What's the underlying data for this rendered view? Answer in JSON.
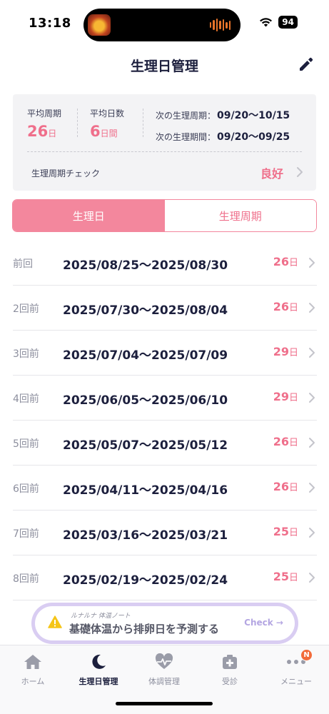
{
  "status_bar": {
    "time": "13:18",
    "battery": "94"
  },
  "header": {
    "title": "生理日管理"
  },
  "summary": {
    "avg_cycle": {
      "label": "平均周期",
      "value": "26",
      "unit": "日"
    },
    "avg_days": {
      "label": "平均日数",
      "value": "6",
      "unit": "日間"
    },
    "next_cycle": {
      "label": "次の生理周期：",
      "value": "09/20〜10/15"
    },
    "next_period": {
      "label": "次の生理期間：",
      "value": "09/20〜09/25"
    },
    "cycle_check": {
      "label": "生理周期チェック",
      "status": "良好"
    }
  },
  "tabs": {
    "period_days": "生理日",
    "cycle": "生理周期",
    "active": "生理日"
  },
  "history": [
    {
      "index": "前回",
      "range": "2025/08/25〜2025/08/30",
      "days": "26",
      "unit": "日"
    },
    {
      "index": "2回前",
      "range": "2025/07/30〜2025/08/04",
      "days": "26",
      "unit": "日"
    },
    {
      "index": "3回前",
      "range": "2025/07/04〜2025/07/09",
      "days": "29",
      "unit": "日"
    },
    {
      "index": "4回前",
      "range": "2025/06/05〜2025/06/10",
      "days": "29",
      "unit": "日"
    },
    {
      "index": "5回前",
      "range": "2025/05/07〜2025/05/12",
      "days": "26",
      "unit": "日"
    },
    {
      "index": "6回前",
      "range": "2025/04/11〜2025/04/16",
      "days": "26",
      "unit": "日"
    },
    {
      "index": "7回前",
      "range": "2025/03/16〜2025/03/21",
      "days": "25",
      "unit": "日"
    },
    {
      "index": "8回前",
      "range": "2025/02/19〜2025/02/24",
      "days": "25",
      "unit": "日"
    }
  ],
  "promo": {
    "small": "ルナルナ 体温ノート",
    "main": "基礎体温から排卵日を予測する",
    "action": "Check →"
  },
  "tabbar": [
    {
      "label": "ホーム",
      "icon": "home-icon"
    },
    {
      "label": "生理日管理",
      "icon": "moon-icon"
    },
    {
      "label": "体調管理",
      "icon": "heart-pulse-icon"
    },
    {
      "label": "受診",
      "icon": "medical-cross-icon"
    },
    {
      "label": "メニュー",
      "icon": "more-dots-icon",
      "badge": "N"
    }
  ],
  "colors": {
    "accent": "#ef6f8b",
    "segment": "#f3879d",
    "text": "#1c1f3d",
    "promo_border": "#d9cdf2"
  }
}
